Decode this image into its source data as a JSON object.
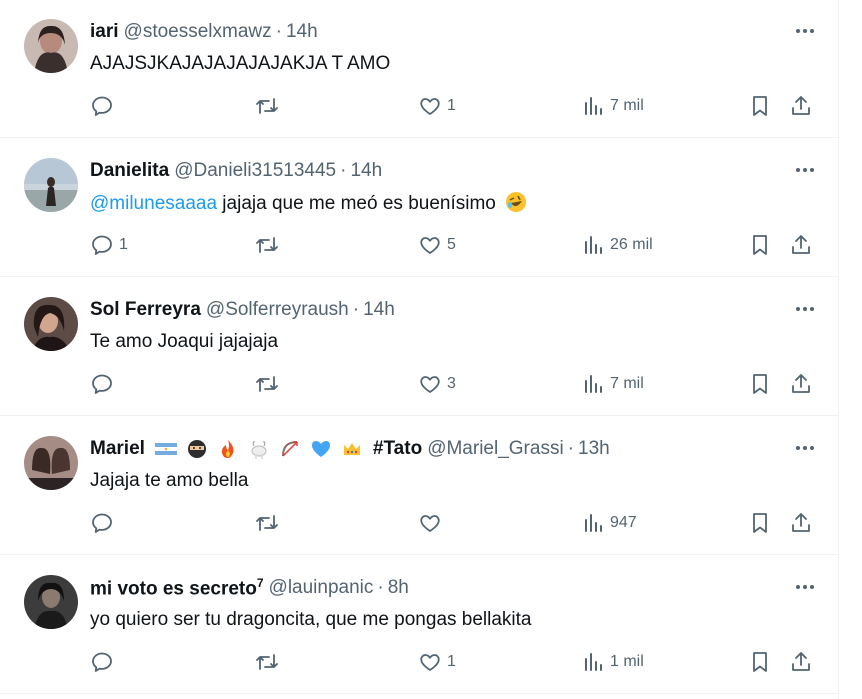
{
  "tweets": [
    {
      "name": "iari",
      "handle": "@stoesselxmawz",
      "time": "14h",
      "text": "AJAJSJKAJAJAJAJAJAKJA T AMO",
      "replies": "",
      "retweets": "",
      "likes": "1",
      "views": "7 mil",
      "avatar_color": "#5a4a48"
    },
    {
      "name": "Danielita",
      "handle": "@Danieli31513445",
      "time": "14h",
      "mention": "@milunesaaaa",
      "text": " jajaja que me meó es buenísimo",
      "emoji": "rolling-laughing-emoji",
      "replies": "1",
      "retweets": "",
      "likes": "5",
      "views": "26 mil",
      "avatar_color": "#9bb0c4"
    },
    {
      "name": "Sol Ferreyra",
      "handle": "@Solferreyraush",
      "time": "14h",
      "text": "Te amo Joaqui jajajaja",
      "replies": "",
      "retweets": "",
      "likes": "3",
      "views": "7 mil",
      "avatar_color": "#3a3030"
    },
    {
      "name": "Mariel",
      "name_tag": "#Tato",
      "handle": "@Mariel_Grassi",
      "time": "13h",
      "text": "Jajaja te amo bella",
      "replies": "",
      "retweets": "",
      "likes": "",
      "views": "947",
      "avatar_color": "#6b5a55",
      "emoji_icons": [
        "argentina-flag-icon",
        "ninja-icon",
        "fire-icon",
        "goat-icon",
        "bow-arrow-icon",
        "blue-heart-icon",
        "crown-icon"
      ]
    },
    {
      "name": "mi voto es secreto",
      "name_sup": "7",
      "handle": "@lauinpanic",
      "time": "8h",
      "text": "yo quiero ser tu dragoncita, que me pongas bellakita",
      "replies": "",
      "retweets": "",
      "likes": "1",
      "views": "1 mil",
      "avatar_color": "#2a2a2a"
    }
  ],
  "colors": {
    "text": "#0f1419",
    "secondary": "#536471",
    "mention": "#1d9bf0",
    "border": "#eff3f4"
  },
  "icons": [
    "reply-icon",
    "retweet-icon",
    "like-icon",
    "views-icon",
    "bookmark-icon",
    "share-icon",
    "more-icon"
  ]
}
